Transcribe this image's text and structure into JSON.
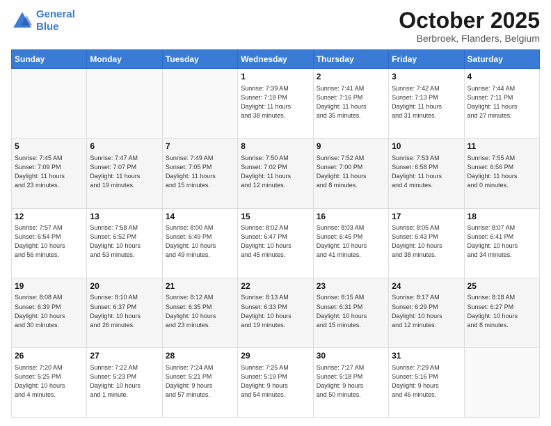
{
  "header": {
    "logo_line1": "General",
    "logo_line2": "Blue",
    "month": "October 2025",
    "location": "Berbroek, Flanders, Belgium"
  },
  "days_of_week": [
    "Sunday",
    "Monday",
    "Tuesday",
    "Wednesday",
    "Thursday",
    "Friday",
    "Saturday"
  ],
  "weeks": [
    [
      {
        "day": "",
        "info": ""
      },
      {
        "day": "",
        "info": ""
      },
      {
        "day": "",
        "info": ""
      },
      {
        "day": "1",
        "info": "Sunrise: 7:39 AM\nSunset: 7:18 PM\nDaylight: 11 hours\nand 38 minutes."
      },
      {
        "day": "2",
        "info": "Sunrise: 7:41 AM\nSunset: 7:16 PM\nDaylight: 11 hours\nand 35 minutes."
      },
      {
        "day": "3",
        "info": "Sunrise: 7:42 AM\nSunset: 7:13 PM\nDaylight: 11 hours\nand 31 minutes."
      },
      {
        "day": "4",
        "info": "Sunrise: 7:44 AM\nSunset: 7:11 PM\nDaylight: 11 hours\nand 27 minutes."
      }
    ],
    [
      {
        "day": "5",
        "info": "Sunrise: 7:45 AM\nSunset: 7:09 PM\nDaylight: 11 hours\nand 23 minutes."
      },
      {
        "day": "6",
        "info": "Sunrise: 7:47 AM\nSunset: 7:07 PM\nDaylight: 11 hours\nand 19 minutes."
      },
      {
        "day": "7",
        "info": "Sunrise: 7:49 AM\nSunset: 7:05 PM\nDaylight: 11 hours\nand 15 minutes."
      },
      {
        "day": "8",
        "info": "Sunrise: 7:50 AM\nSunset: 7:02 PM\nDaylight: 11 hours\nand 12 minutes."
      },
      {
        "day": "9",
        "info": "Sunrise: 7:52 AM\nSunset: 7:00 PM\nDaylight: 11 hours\nand 8 minutes."
      },
      {
        "day": "10",
        "info": "Sunrise: 7:53 AM\nSunset: 6:58 PM\nDaylight: 11 hours\nand 4 minutes."
      },
      {
        "day": "11",
        "info": "Sunrise: 7:55 AM\nSunset: 6:56 PM\nDaylight: 11 hours\nand 0 minutes."
      }
    ],
    [
      {
        "day": "12",
        "info": "Sunrise: 7:57 AM\nSunset: 6:54 PM\nDaylight: 10 hours\nand 56 minutes."
      },
      {
        "day": "13",
        "info": "Sunrise: 7:58 AM\nSunset: 6:52 PM\nDaylight: 10 hours\nand 53 minutes."
      },
      {
        "day": "14",
        "info": "Sunrise: 8:00 AM\nSunset: 6:49 PM\nDaylight: 10 hours\nand 49 minutes."
      },
      {
        "day": "15",
        "info": "Sunrise: 8:02 AM\nSunset: 6:47 PM\nDaylight: 10 hours\nand 45 minutes."
      },
      {
        "day": "16",
        "info": "Sunrise: 8:03 AM\nSunset: 6:45 PM\nDaylight: 10 hours\nand 41 minutes."
      },
      {
        "day": "17",
        "info": "Sunrise: 8:05 AM\nSunset: 6:43 PM\nDaylight: 10 hours\nand 38 minutes."
      },
      {
        "day": "18",
        "info": "Sunrise: 8:07 AM\nSunset: 6:41 PM\nDaylight: 10 hours\nand 34 minutes."
      }
    ],
    [
      {
        "day": "19",
        "info": "Sunrise: 8:08 AM\nSunset: 6:39 PM\nDaylight: 10 hours\nand 30 minutes."
      },
      {
        "day": "20",
        "info": "Sunrise: 8:10 AM\nSunset: 6:37 PM\nDaylight: 10 hours\nand 26 minutes."
      },
      {
        "day": "21",
        "info": "Sunrise: 8:12 AM\nSunset: 6:35 PM\nDaylight: 10 hours\nand 23 minutes."
      },
      {
        "day": "22",
        "info": "Sunrise: 8:13 AM\nSunset: 6:33 PM\nDaylight: 10 hours\nand 19 minutes."
      },
      {
        "day": "23",
        "info": "Sunrise: 8:15 AM\nSunset: 6:31 PM\nDaylight: 10 hours\nand 15 minutes."
      },
      {
        "day": "24",
        "info": "Sunrise: 8:17 AM\nSunset: 6:29 PM\nDaylight: 10 hours\nand 12 minutes."
      },
      {
        "day": "25",
        "info": "Sunrise: 8:18 AM\nSunset: 6:27 PM\nDaylight: 10 hours\nand 8 minutes."
      }
    ],
    [
      {
        "day": "26",
        "info": "Sunrise: 7:20 AM\nSunset: 5:25 PM\nDaylight: 10 hours\nand 4 minutes."
      },
      {
        "day": "27",
        "info": "Sunrise: 7:22 AM\nSunset: 5:23 PM\nDaylight: 10 hours\nand 1 minute."
      },
      {
        "day": "28",
        "info": "Sunrise: 7:24 AM\nSunset: 5:21 PM\nDaylight: 9 hours\nand 57 minutes."
      },
      {
        "day": "29",
        "info": "Sunrise: 7:25 AM\nSunset: 5:19 PM\nDaylight: 9 hours\nand 54 minutes."
      },
      {
        "day": "30",
        "info": "Sunrise: 7:27 AM\nSunset: 5:18 PM\nDaylight: 9 hours\nand 50 minutes."
      },
      {
        "day": "31",
        "info": "Sunrise: 7:29 AM\nSunset: 5:16 PM\nDaylight: 9 hours\nand 46 minutes."
      },
      {
        "day": "",
        "info": ""
      }
    ]
  ]
}
